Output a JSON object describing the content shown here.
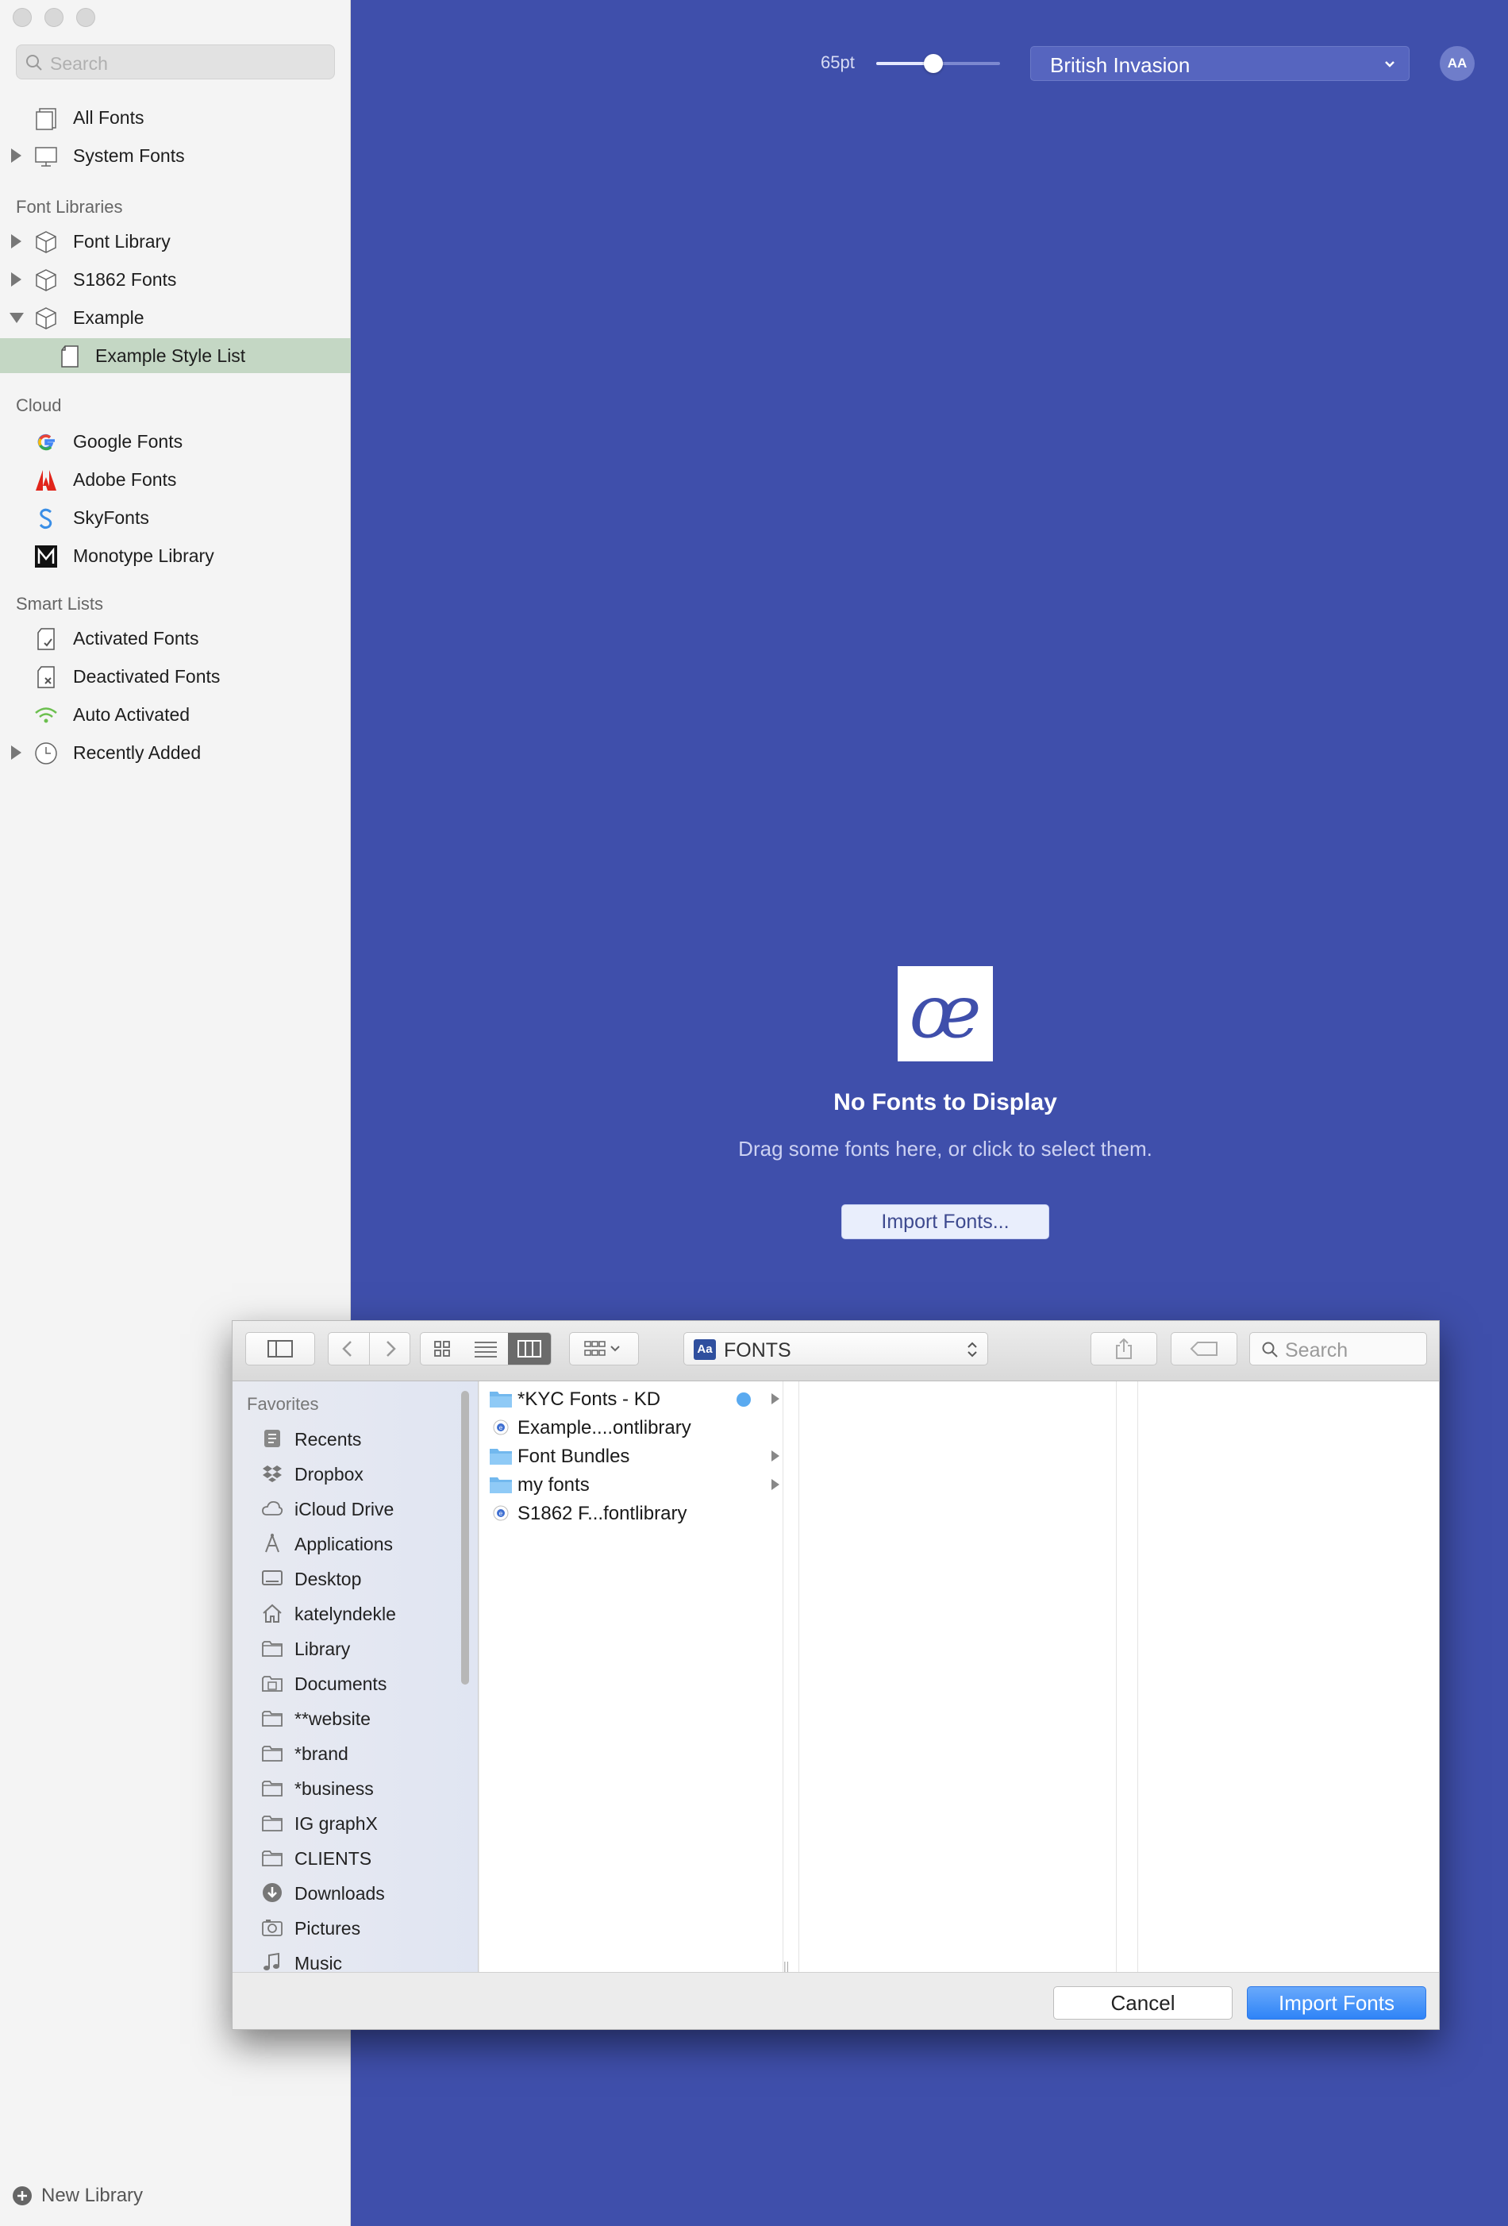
{
  "sidebar": {
    "search_placeholder": "Search",
    "top_items": [
      {
        "label": "All Fonts",
        "icon": "all-fonts-icon"
      },
      {
        "label": "System Fonts",
        "icon": "monitor-icon"
      }
    ],
    "libraries_heading": "Font Libraries",
    "libraries": [
      {
        "label": "Font Library",
        "icon": "box-icon"
      },
      {
        "label": "S1862 Fonts",
        "icon": "box-icon"
      },
      {
        "label": "Example",
        "icon": "box-icon"
      }
    ],
    "selected_item": "Example Style List",
    "cloud_heading": "Cloud",
    "cloud": [
      {
        "label": "Google Fonts",
        "icon": "google-icon"
      },
      {
        "label": "Adobe Fonts",
        "icon": "adobe-icon"
      },
      {
        "label": "SkyFonts",
        "icon": "skyfonts-icon"
      },
      {
        "label": "Monotype Library",
        "icon": "monotype-icon"
      }
    ],
    "smart_heading": "Smart Lists",
    "smart": [
      {
        "label": "Activated Fonts",
        "icon": "activated-icon"
      },
      {
        "label": "Deactivated Fonts",
        "icon": "deactivated-icon"
      },
      {
        "label": "Auto Activated",
        "icon": "wifi-icon"
      },
      {
        "label": "Recently Added",
        "icon": "clock-icon"
      }
    ],
    "new_library": "New Library"
  },
  "toolbar": {
    "size_label": "65pt",
    "size_slider_fraction": 0.46,
    "preview_text": "British Invasion",
    "aa_label": "AA"
  },
  "empty_state": {
    "logo_glyph": "œ",
    "title": "No Fonts to Display",
    "subtitle": "Drag some fonts here, or click to select them.",
    "import_button": "Import Fonts..."
  },
  "dialog": {
    "location": "FONTS",
    "search_placeholder": "Search",
    "favorites_heading": "Favorites",
    "favorites": [
      {
        "label": "Recents",
        "icon": "recents-icon"
      },
      {
        "label": "Dropbox",
        "icon": "dropbox-icon"
      },
      {
        "label": "iCloud Drive",
        "icon": "cloud-icon"
      },
      {
        "label": "Applications",
        "icon": "applications-icon"
      },
      {
        "label": "Desktop",
        "icon": "desktop-icon"
      },
      {
        "label": "katelyndekle",
        "icon": "home-icon"
      },
      {
        "label": "Library",
        "icon": "folder-icon"
      },
      {
        "label": "Documents",
        "icon": "documents-icon"
      },
      {
        "label": "**website",
        "icon": "folder-icon"
      },
      {
        "label": "*brand",
        "icon": "folder-icon"
      },
      {
        "label": "*business",
        "icon": "folder-icon"
      },
      {
        "label": "IG graphX",
        "icon": "folder-icon"
      },
      {
        "label": "CLIENTS",
        "icon": "folder-icon"
      },
      {
        "label": "Downloads",
        "icon": "downloads-icon"
      },
      {
        "label": "Pictures",
        "icon": "pictures-icon"
      },
      {
        "label": "Music",
        "icon": "music-icon"
      }
    ],
    "files": [
      {
        "label": "*KYC Fonts - KD",
        "type": "folder",
        "tagged": true,
        "arrow": true
      },
      {
        "label": "Example....ontlibrary",
        "type": "library",
        "tagged": false,
        "arrow": false
      },
      {
        "label": "Font Bundles",
        "type": "folder",
        "tagged": false,
        "arrow": true
      },
      {
        "label": "my fonts",
        "type": "folder",
        "tagged": false,
        "arrow": true
      },
      {
        "label": "S1862 F...fontlibrary",
        "type": "library",
        "tagged": false,
        "arrow": false
      }
    ],
    "tag_color": "#5aaaf0",
    "cancel": "Cancel",
    "import": "Import Fonts"
  },
  "colors": {
    "main_background": "#3f4fab",
    "selection": "#c4d7c4",
    "primary_button": "#2f84f7"
  }
}
